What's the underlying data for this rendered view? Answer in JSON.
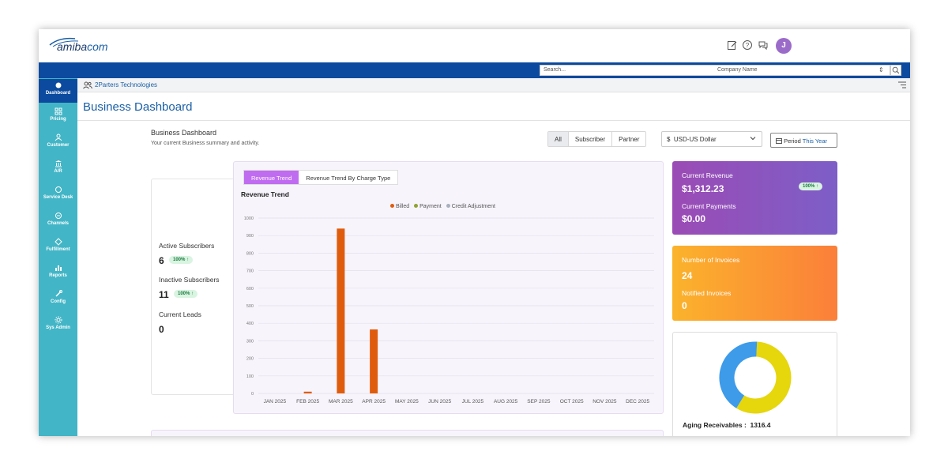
{
  "brand": {
    "logo_main": "amiba",
    "logo_suffix": "com"
  },
  "user": {
    "avatar_initial": "J"
  },
  "header": {
    "search_placeholder": "Search...",
    "company_select": "Company Name",
    "company_select_arrow": "⇕"
  },
  "sidebar": {
    "items": [
      {
        "label": "Dashboard",
        "icon": "dashboard-icon"
      },
      {
        "label": "Pricing",
        "icon": "pricing-icon"
      },
      {
        "label": "Customer",
        "icon": "customer-icon"
      },
      {
        "label": "A/R",
        "icon": "bank-icon"
      },
      {
        "label": "Service Desk",
        "icon": "service-desk-icon"
      },
      {
        "label": "Channels",
        "icon": "channels-icon"
      },
      {
        "label": "Fulfillment",
        "icon": "fulfillment-icon"
      },
      {
        "label": "Reports",
        "icon": "reports-icon"
      },
      {
        "label": "Config",
        "icon": "config-icon"
      },
      {
        "label": "Sys Admin",
        "icon": "gear-icon"
      }
    ]
  },
  "breadcrumb": {
    "company": "2Parters Technologies"
  },
  "page": {
    "title": "Business Dashboard",
    "subtitle": "Business Dashboard",
    "description": "Your current Business summary and activity."
  },
  "filters": {
    "tabs": [
      "All",
      "Subscriber",
      "Partner"
    ],
    "currency_symbol": "$",
    "currency": "USD-US Dollar",
    "period_label": "Period",
    "period_value": "This Year"
  },
  "subscribers": {
    "active_label": "Active Subscribers",
    "active_value": "6",
    "active_badge": "100% ↑",
    "inactive_label": "Inactive Subscribers",
    "inactive_value": "11",
    "inactive_badge": "100% ↑",
    "leads_label": "Current Leads",
    "leads_value": "0"
  },
  "revenue": {
    "tab_1": "Revenue Trend",
    "tab_2": "Revenue Trend By Charge Type",
    "title": "Revenue Trend",
    "legend": [
      "Billed",
      "Payment",
      "Credit Adjustment"
    ]
  },
  "chart_data": {
    "type": "bar",
    "categories": [
      "JAN 2025",
      "FEB 2025",
      "MAR 2025",
      "APR 2025",
      "MAY 2025",
      "JUN 2025",
      "JUL 2025",
      "AUG 2025",
      "SEP 2025",
      "OCT 2025",
      "NOV 2025",
      "DEC 2025"
    ],
    "series": [
      {
        "name": "Billed",
        "color": "#e05c0d",
        "values": [
          0,
          10,
          940,
          365,
          0,
          0,
          0,
          0,
          0,
          0,
          0,
          0
        ]
      },
      {
        "name": "Payment",
        "color": "#8fa331",
        "values": [
          0,
          0,
          0,
          0,
          0,
          0,
          0,
          0,
          0,
          0,
          0,
          0
        ]
      },
      {
        "name": "Credit Adjustment",
        "color": "#a7b0bd",
        "values": [
          0,
          0,
          0,
          0,
          0,
          0,
          0,
          0,
          0,
          0,
          0,
          0
        ]
      }
    ],
    "ylim": [
      0,
      1000
    ],
    "yticks": [
      0,
      100,
      200,
      300,
      400,
      500,
      600,
      700,
      800,
      900,
      1000
    ],
    "title": "Revenue Trend",
    "grid": true,
    "legend_position": "top-center"
  },
  "cards": {
    "current_revenue_label": "Current Revenue",
    "current_revenue_value": "$1,312.23",
    "current_revenue_badge": "100% ↑",
    "current_payments_label": "Current Payments",
    "current_payments_value": "$0.00",
    "invoices_label": "Number of Invoices",
    "invoices_value": "24",
    "notified_label": "Notified Invoices",
    "notified_value": "0",
    "aging_label": "Aging Receivables :",
    "aging_value": "1316.4",
    "aging_slices": [
      {
        "value": 0.58,
        "color": "#e6d60c"
      },
      {
        "value": 0.42,
        "color": "#3d9be9"
      }
    ]
  }
}
